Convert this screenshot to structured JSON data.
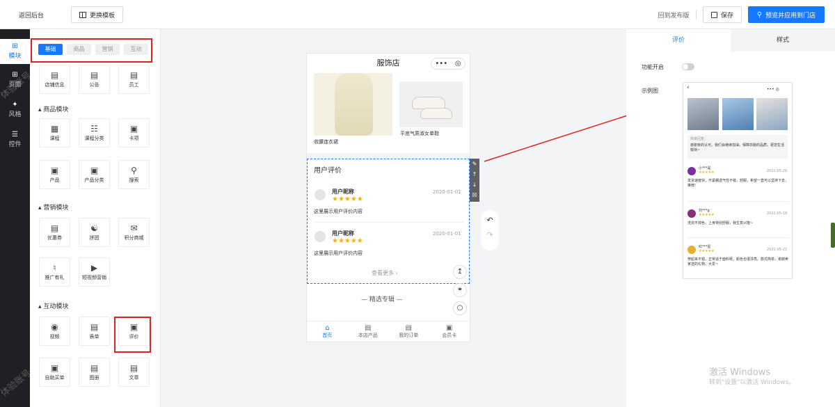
{
  "topbar": {
    "back": "返回后台",
    "template": "更换模板",
    "back_publish": "回到发布版",
    "save": "保存",
    "preview": "预览并应用到门店"
  },
  "rail": [
    {
      "label": "模块",
      "icon": "plus-square-icon"
    },
    {
      "label": "页面",
      "icon": "plus-square-icon"
    },
    {
      "label": "风格",
      "icon": "wand-icon"
    },
    {
      "label": "控件",
      "icon": "sliders-icon"
    }
  ],
  "watermark": "体验账号",
  "panel": {
    "tabs": [
      "基础",
      "商品",
      "营销",
      "互动"
    ],
    "row0": [
      "店铺信息",
      "公告",
      "员工"
    ],
    "sections": [
      "商品模块",
      "营销模块",
      "互动模块"
    ],
    "goods": [
      "课程",
      "课程分类",
      "卡项",
      "产品",
      "产品分类",
      "搜索"
    ],
    "marketing": [
      "优惠券",
      "拼团",
      "积分商城",
      "推广有礼",
      "短视频营销"
    ],
    "interact": [
      "视频",
      "表单",
      "评价",
      "自助买单",
      "图册",
      "文章"
    ]
  },
  "phone": {
    "title": "服饰店",
    "prod1": "收腰连衣裙",
    "prod2": "平底气质淑女单鞋",
    "review_title": "用户评价",
    "reviews": [
      {
        "name": "用户昵称",
        "date": "2020-01-01",
        "content": "这里展示用户评价内容"
      },
      {
        "name": "用户昵称",
        "date": "2020-01-01",
        "content": "这里展示用户评价内容"
      }
    ],
    "more": "查看更多",
    "album": "精选专辑",
    "nav": [
      "首页",
      "本店产品",
      "我的订单",
      "会员卡"
    ]
  },
  "right": {
    "tabs": [
      "评价",
      "样式"
    ],
    "toggle_label": "功能开启",
    "example_label": "示例图",
    "preview": {
      "reply": "商家回复：",
      "reply_text": "谢谢亲的认可，我们会继续加油，保障衣服的品质，祝您生活愉快~",
      "items": [
        {
          "name": "小***是",
          "date": "2021-05-20",
          "text": "发货速度快，不紧绷透气性不错，舒服，希望一直可以坚持下去，推荐!"
        },
        {
          "name": "刘***g",
          "date": "2021-05-19",
          "text": "洗完不掉色，上身特别舒服，我生意兴隆~"
        },
        {
          "name": "红***星",
          "date": "2021-05-22",
          "text": "穿起来不错，正常适于面料呢，颜色也很漂亮。款式简单，谢谢卖家送的礼物，大爱~"
        }
      ]
    }
  },
  "windows": {
    "line1": "激活 Windows",
    "line2": "转到\"设置\"以激活 Windows。"
  },
  "colors": {
    "accent": "#1677ff",
    "red": "#e02020",
    "star": "#f5b400"
  }
}
